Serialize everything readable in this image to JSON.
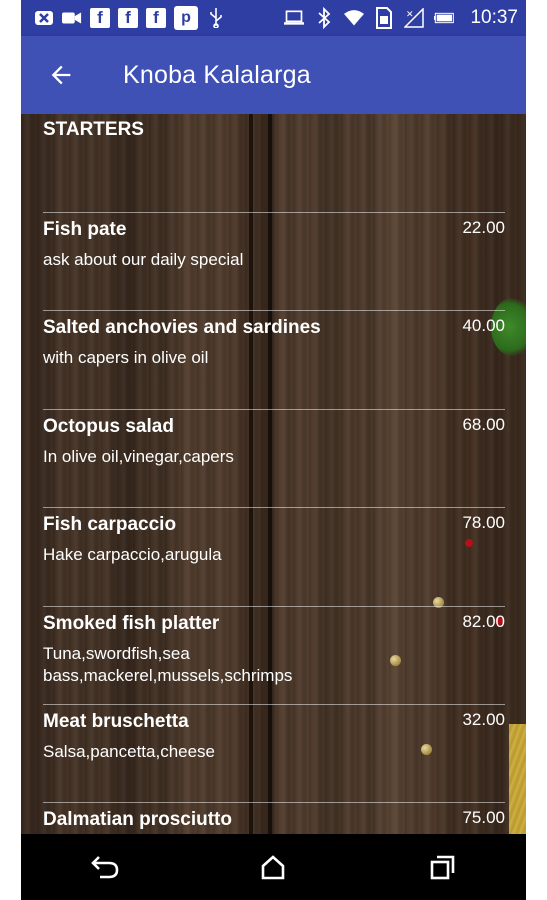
{
  "status_bar": {
    "time": "10:37",
    "icons": [
      "x-badge-icon",
      "video-icon",
      "facebook-icon",
      "facebook-icon",
      "facebook-icon",
      "p-app-icon",
      "usb-icon",
      "laptop-icon",
      "bluetooth-icon",
      "wifi-icon",
      "sim-icon",
      "signal-icon",
      "battery-icon"
    ],
    "fb_letter": "f",
    "p_letter": "p",
    "x_letter": "✕"
  },
  "app_bar": {
    "title": "Knoba Kalalarga",
    "back_icon": "arrow-back-icon"
  },
  "menu": {
    "section_title": "STARTERS",
    "items": [
      {
        "name": "Fish pate",
        "description": "ask about our daily special",
        "price": "22.00"
      },
      {
        "name": "Salted anchovies and sardines",
        "description": "with capers in olive oil",
        "price": "40.00"
      },
      {
        "name": "Octopus salad",
        "description": "In olive oil,vinegar,capers",
        "price": "68.00"
      },
      {
        "name": "Fish carpaccio",
        "description": "Hake carpaccio,arugula",
        "price": "78.00"
      },
      {
        "name": "Smoked fish platter",
        "description": "Tuna,swordfish,sea bass,mackerel,mussels,schrimps",
        "price": "82.00"
      },
      {
        "name": "Meat bruschetta",
        "description": "Salsa,pancetta,cheese",
        "price": "32.00"
      },
      {
        "name": "Dalmatian prosciutto",
        "description": "",
        "price": "75.00"
      }
    ]
  },
  "nav_bar": {
    "buttons": [
      "back-triangle-icon",
      "home-icon",
      "recents-icon"
    ]
  },
  "colors": {
    "status_bar": "#2f3ea3",
    "app_bar": "#3f51b5",
    "text": "#ffffff"
  }
}
